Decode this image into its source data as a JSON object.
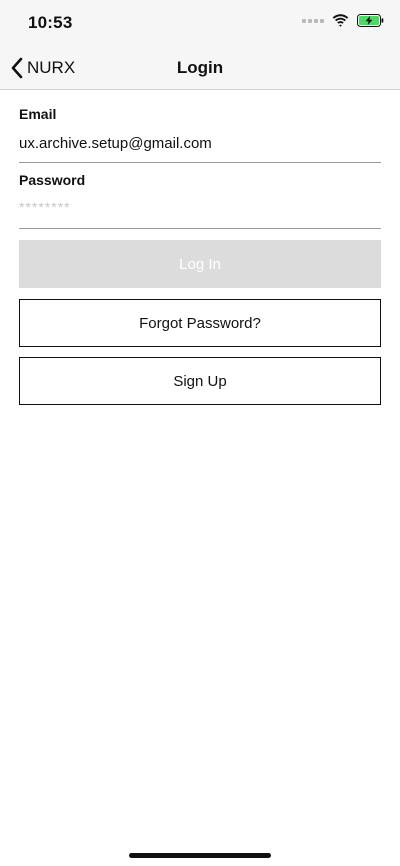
{
  "status_bar": {
    "time": "10:53",
    "icons": [
      "cellular-signal-icon",
      "wifi-icon",
      "battery-charging-icon"
    ],
    "battery_color": "#4cd964"
  },
  "nav": {
    "back_label": "NURX",
    "title": "Login"
  },
  "form": {
    "email": {
      "label": "Email",
      "value": "ux.archive.setup@gmail.com"
    },
    "password": {
      "label": "Password",
      "value": "********"
    }
  },
  "buttons": {
    "login": "Log In",
    "forgot_password": "Forgot Password?",
    "sign_up": "Sign Up"
  },
  "colors": {
    "disabled_button": "#dcdcdc",
    "text": "#111111",
    "background": "#ffffff"
  }
}
